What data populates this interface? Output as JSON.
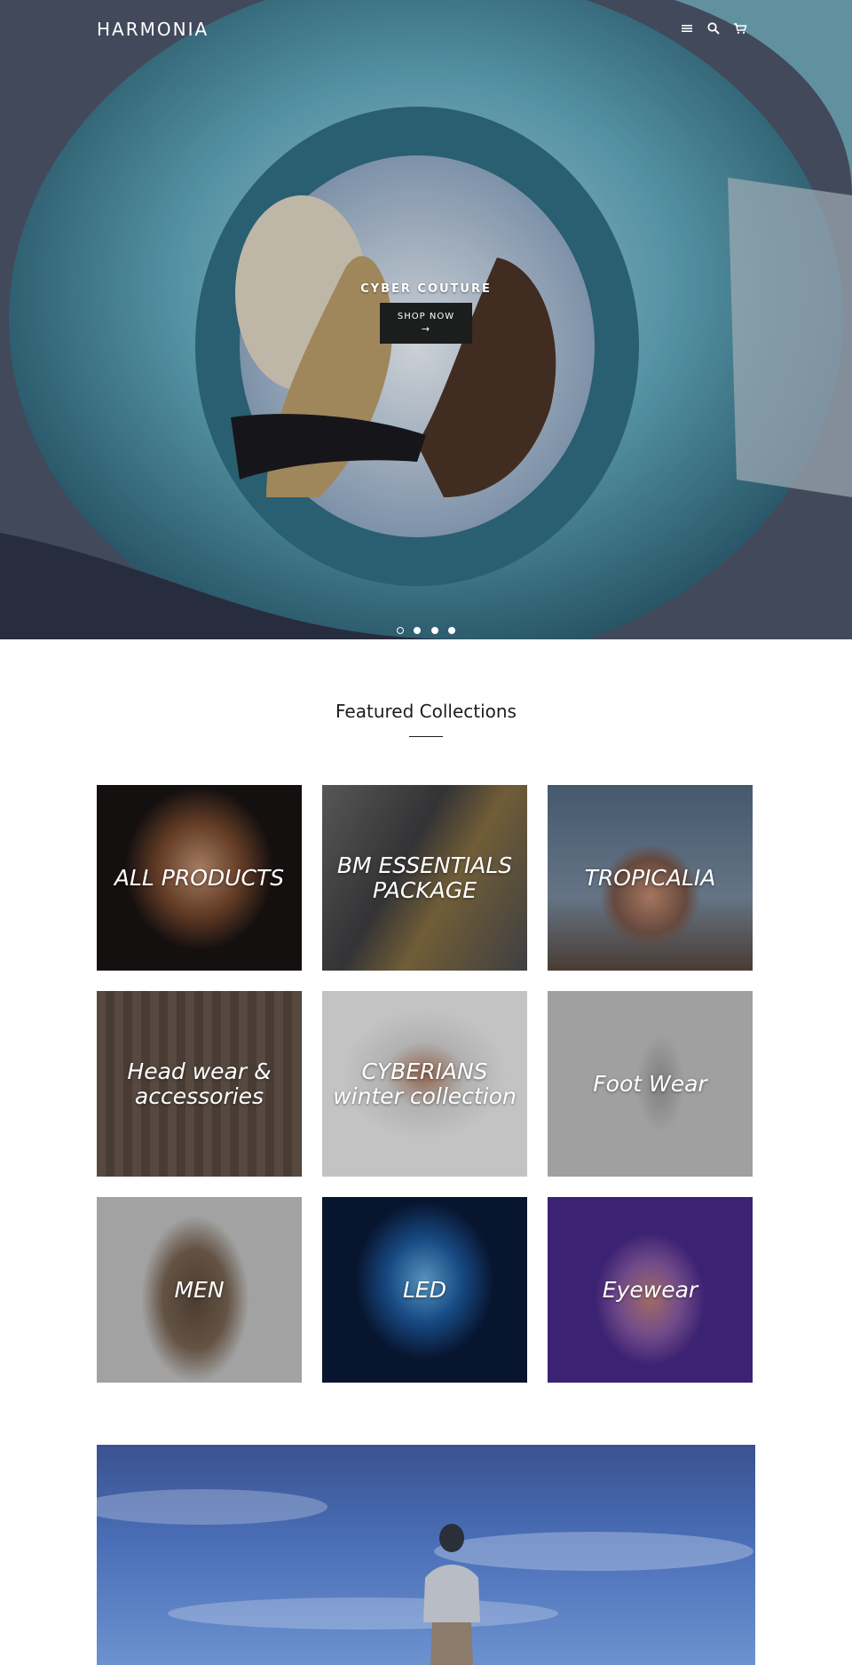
{
  "header": {
    "logo": "HARMONIA",
    "icons": [
      "menu-icon",
      "search-icon",
      "cart-icon"
    ]
  },
  "hero": {
    "title": "CYBER COUTURE",
    "button_label": "SHOP NOW",
    "button_arrow": "→",
    "slides_count": 4,
    "active_slide": 1
  },
  "featured": {
    "title": "Featured Collections",
    "collections": [
      {
        "label": "ALL PRODUCTS"
      },
      {
        "label": "BM ESSENTIALS PACKAGE"
      },
      {
        "label": "TROPICALIA"
      },
      {
        "label": "Head wear & accessories"
      },
      {
        "label": "CYBERIANS winter collection"
      },
      {
        "label": "Foot Wear"
      },
      {
        "label": "MEN"
      },
      {
        "label": "LED"
      },
      {
        "label": "Eyewear"
      }
    ]
  },
  "colors": {
    "text": "#1c1d1d",
    "button_bg": "#1c1d1d",
    "white": "#ffffff"
  }
}
